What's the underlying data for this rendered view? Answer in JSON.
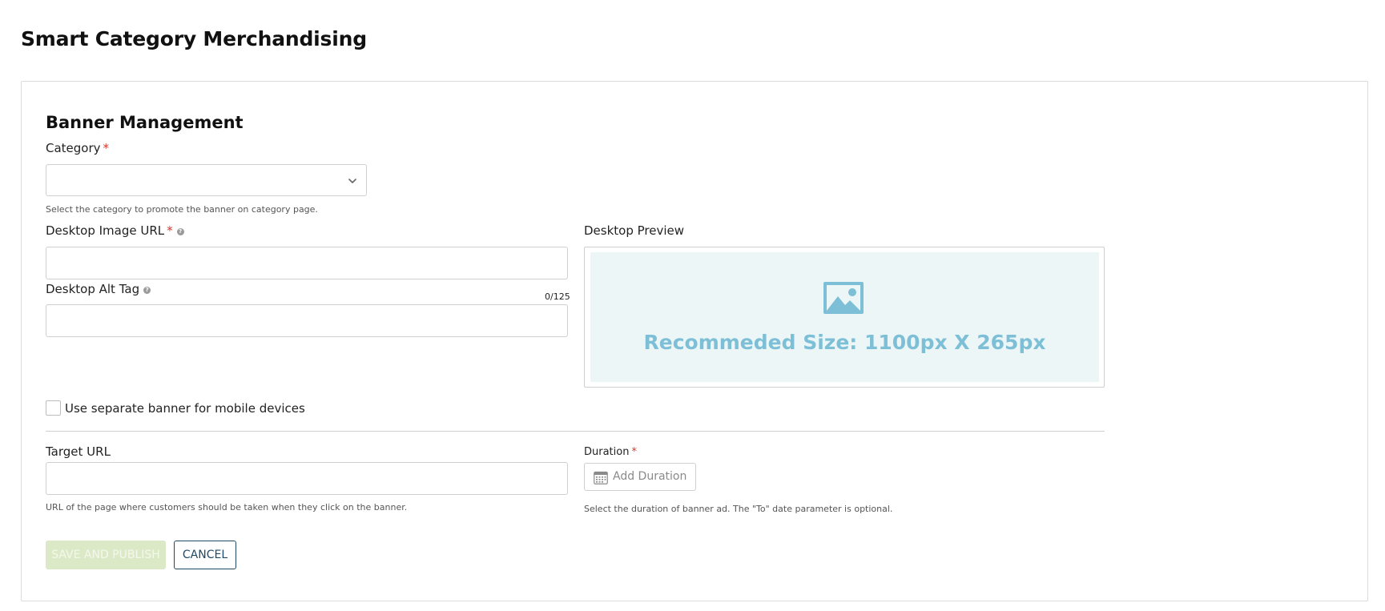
{
  "page": {
    "title": "Smart Category Merchandising"
  },
  "banner": {
    "section_title": "Banner Management",
    "category": {
      "label": "Category",
      "required_mark": "*",
      "value": "",
      "hint": "Select the category to promote the banner on category page."
    },
    "desktop_image_url": {
      "label": "Desktop Image URL",
      "required_mark": "*",
      "help_glyph": "?",
      "value": ""
    },
    "desktop_alt_tag": {
      "label": "Desktop Alt Tag",
      "help_glyph": "?",
      "value": "",
      "counter": "0/125"
    },
    "desktop_preview": {
      "label": "Desktop Preview",
      "placeholder_text": "Recommeded Size: 1100px X 265px",
      "icon": "image-icon"
    },
    "mobile_banner": {
      "label": "Use separate banner for mobile devices",
      "checked": false
    },
    "target_url": {
      "label": "Target URL",
      "value": "",
      "hint": "URL of the page where customers should be taken when they click on the banner."
    },
    "duration": {
      "label": "Duration",
      "required_mark": "*",
      "button_label": "Add Duration",
      "icon": "calendar-icon",
      "hint": "Select the duration of banner ad. The \"To\" date parameter is optional."
    },
    "actions": {
      "save_label": "SAVE AND PUBLISH",
      "cancel_label": "CANCEL"
    }
  },
  "colors": {
    "required": "#d9342b",
    "preview_bg": "#edf6f6",
    "preview_accent": "#7dbfd6",
    "save_disabled_bg": "#dce9c7",
    "cancel_accent": "#1f4a66"
  }
}
